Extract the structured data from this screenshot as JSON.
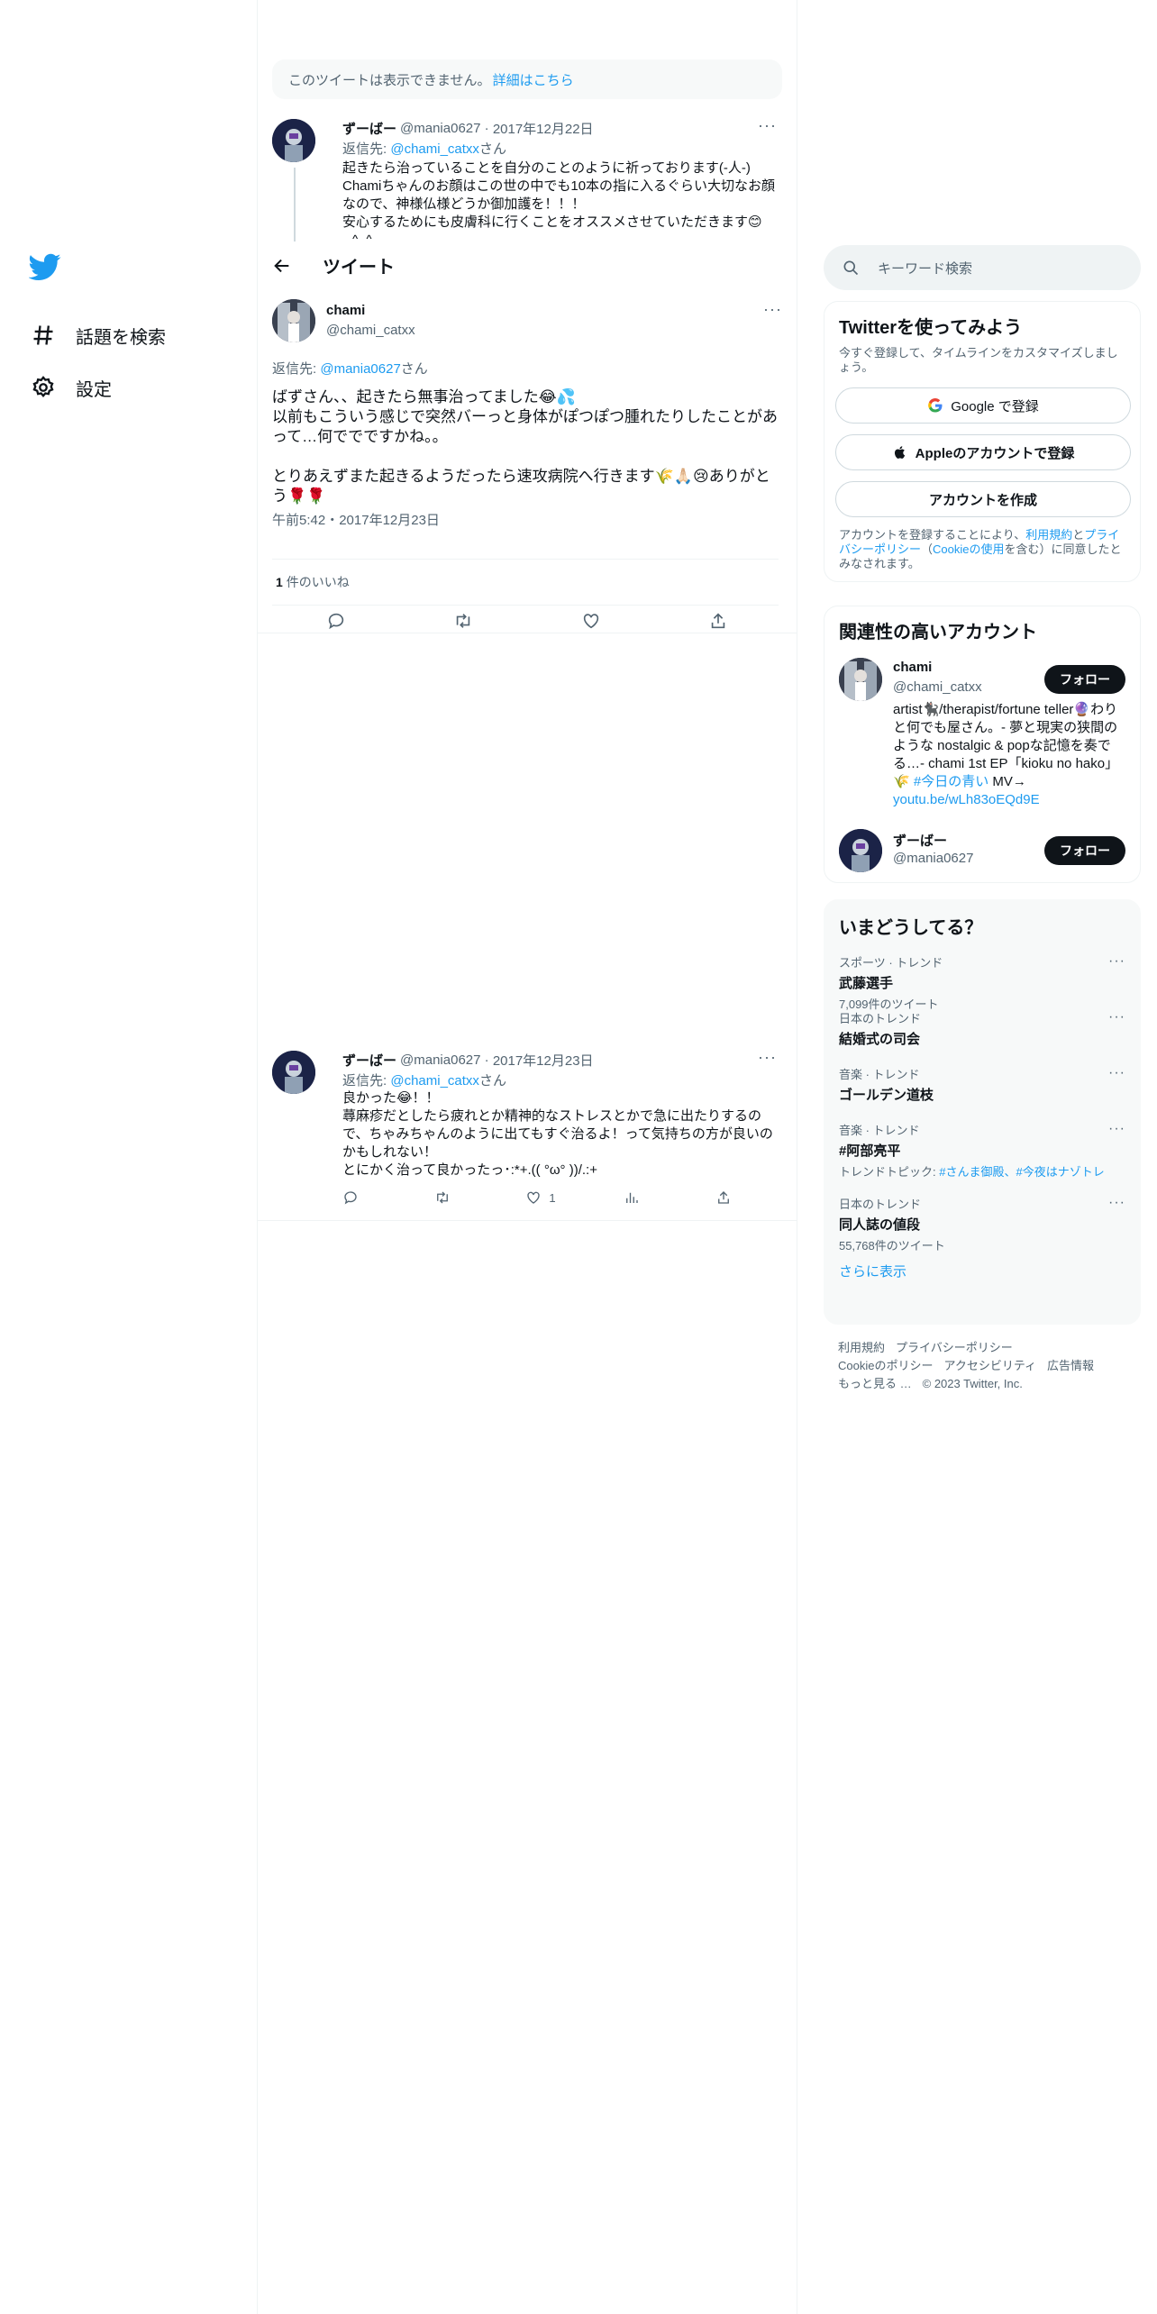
{
  "nav": {
    "explore_label": "話題を検索",
    "settings_label": "設定"
  },
  "notice": {
    "text": "このツイートは表示できません。",
    "link": "詳細はこちら"
  },
  "tweet1": {
    "name": "ずーばー",
    "handle": "@mania0627",
    "date": "2017年12月22日",
    "reply_prefix": "返信先: ",
    "reply_to": "@chami_catxx",
    "reply_suffix": "さん",
    "text": "起きたら治っていることを自分のことのように祈っております(-人-)\nChamiちゃんのお顔はこの世の中でも10本の指に入るぐらい大切なお顔なので、神様仏様どうか御加護を！！！\n安心するためにも皮膚科に行くことをオススメさせていただきます😊┐^_^┐\n\""
  },
  "focus_header": {
    "title": "ツイート"
  },
  "focus_tweet": {
    "name": "chami",
    "handle": "@chami_catxx",
    "reply_prefix": "返信先: ",
    "reply_to": "@mania0627",
    "reply_suffix": "さん",
    "text": "ばずさん、、起きたら無事治ってました😂💦\n以前もこういう感じで突然バーっと身体がぽつぽつ腫れたりしたことがあって…何ででですかね。。\n\nとりあえずまた起きるようだったら速攻病院へ行きます🌾🙏🏻😢ありがとう🌹🌹",
    "time": "午前5:42・2017年12月23日",
    "likes_count": "1",
    "likes_label": "件のいいね"
  },
  "tweet2": {
    "name": "ずーばー",
    "handle": "@mania0627",
    "date": "2017年12月23日",
    "reply_prefix": "返信先: ",
    "reply_to": "@chami_catxx",
    "reply_suffix": "さん",
    "text": "良かった😂！！\n蕁麻疹だとしたら疲れとか精神的なストレスとかで急に出たりするので、ちゃみちゃんのように出てもすぐ治るよ！って気持ちの方が良いのかもしれない！\nとにかく治って良かったっ･:*+.(( °ω° ))/.:+",
    "like_count": "1"
  },
  "search": {
    "placeholder": "キーワード検索"
  },
  "signup": {
    "title": "Twitterを使ってみよう",
    "subtitle": "今すぐ登録して、タイムラインをカスタマイズしましょう。",
    "google_label": "Google で登録",
    "apple_label": "Appleのアカウントで登録",
    "create_label": "アカウントを作成",
    "legal_1": "アカウントを登録することにより、",
    "legal_terms": "利用規約",
    "legal_2": "と",
    "legal_privacy": "プライバシーポリシー",
    "legal_3": "（",
    "legal_cookie": "Cookieの使用",
    "legal_4": "を含む）に同意したとみなされます。"
  },
  "relevant": {
    "title": "関連性の高いアカウント",
    "accounts": [
      {
        "name": "chami",
        "handle": "@chami_catxx",
        "follow_label": "フォロー",
        "bio": "artist🐈‍⬛/therapist/fortune teller🔮わりと何でも屋さん。- 夢と現実の狭間のような nostalgic & popな記憶を奏でる…- chami 1st EP「kioku no hako」🌾 ",
        "bio_tag": "#今日の青い",
        "bio_mid": " MV→ ",
        "bio_link": "youtu.be/wLh83oEQd9E"
      },
      {
        "name": "ずーばー",
        "handle": "@mania0627",
        "follow_label": "フォロー"
      }
    ]
  },
  "trends": {
    "title": "いまどうしてる？",
    "items": [
      {
        "context": "スポーツ · トレンド",
        "title": "武藤選手",
        "count": "7,099件のツイート"
      },
      {
        "context": "日本のトレンド",
        "title": "結婚式の司会",
        "count": ""
      },
      {
        "context": "音楽 · トレンド",
        "title": "ゴールデン道枝",
        "count": ""
      },
      {
        "context": "音楽 · トレンド",
        "title": "#阿部亮平",
        "count_prefix": "トレンドトピック: ",
        "count_links": "#さんま御殿、#今夜はナゾトレ"
      },
      {
        "context": "日本のトレンド",
        "title": "同人誌の値段",
        "count": "55,768件のツイート"
      }
    ],
    "show_more": "さらに表示"
  },
  "footer": {
    "terms": "利用規約",
    "privacy": "プライバシーポリシー",
    "cookie": "Cookieのポリシー",
    "accessibility": "アクセシビリティ",
    "ads": "広告情報",
    "more": "もっと見る …",
    "copyright": "© 2023 Twitter, Inc."
  }
}
